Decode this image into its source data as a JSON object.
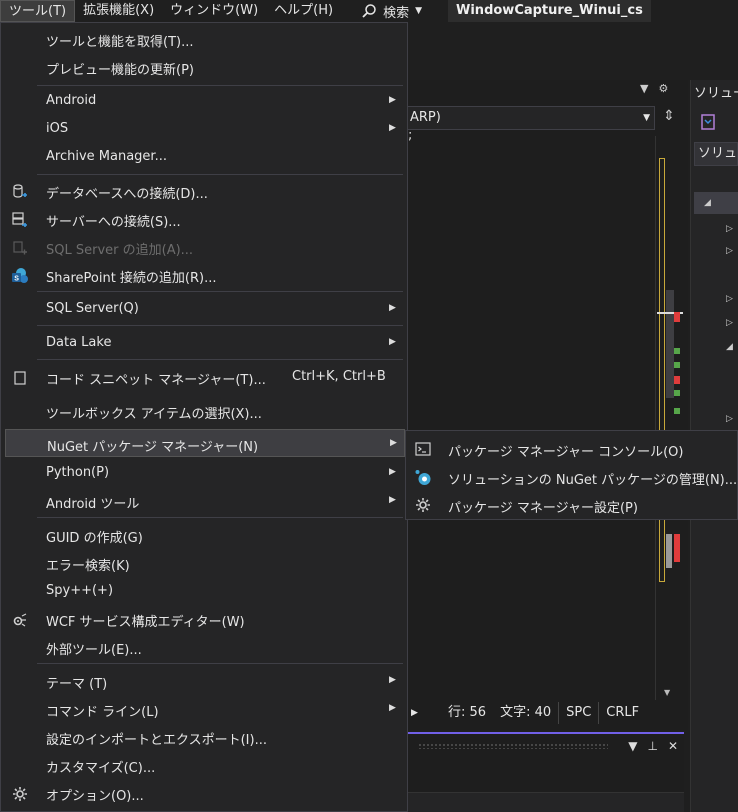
{
  "menubar": {
    "items": [
      {
        "label": "ツール(T)",
        "active": true
      },
      {
        "label": "拡張機能(X)"
      },
      {
        "label": "ウィンドウ(W)"
      },
      {
        "label": "ヘルプ(H)"
      }
    ],
    "search_label": "検索",
    "window_title": "WindowCapture_Winui_cs"
  },
  "editor": {
    "combo_value": "ARP)",
    "code_text": ";",
    "status": {
      "line": "行: 56",
      "col": "文字: 40",
      "spc": "SPC",
      "crlf": "CRLF"
    }
  },
  "solution_explorer": {
    "title": "ソリュー",
    "search": "ソリュー"
  },
  "tools_menu": {
    "items": [
      {
        "label": "ツールと機能を取得(T)..."
      },
      {
        "label": "プレビュー機能の更新(P)"
      },
      {
        "label": "Android"
      },
      {
        "label": "iOS"
      },
      {
        "label": "Archive Manager..."
      },
      {
        "label": "データベースへの接続(D)..."
      },
      {
        "label": "サーバーへの接続(S)..."
      },
      {
        "label": "SQL Server の追加(A)..."
      },
      {
        "label": "SharePoint 接続の追加(R)..."
      },
      {
        "label": "SQL Server(Q)"
      },
      {
        "label": "Data Lake"
      },
      {
        "label": "コード スニペット マネージャー(T)...",
        "shortcut": "Ctrl+K, Ctrl+B"
      },
      {
        "label": "ツールボックス アイテムの選択(X)..."
      },
      {
        "label": "NuGet パッケージ マネージャー(N)"
      },
      {
        "label": "Python(P)"
      },
      {
        "label": "Android ツール"
      },
      {
        "label": "GUID の作成(G)"
      },
      {
        "label": "エラー検索(K)"
      },
      {
        "label": "Spy++(+)"
      },
      {
        "label": "WCF サービス構成エディター(W)"
      },
      {
        "label": "外部ツール(E)..."
      },
      {
        "label": "テーマ (T)"
      },
      {
        "label": "コマンド ライン(L)"
      },
      {
        "label": "設定のインポートとエクスポート(I)..."
      },
      {
        "label": "カスタマイズ(C)..."
      },
      {
        "label": "オプション(O)..."
      }
    ]
  },
  "nuget_submenu": {
    "items": [
      {
        "label": "パッケージ マネージャー コンソール(O)"
      },
      {
        "label": "ソリューションの NuGet パッケージの管理(N)..."
      },
      {
        "label": "パッケージ マネージャー設定(P)"
      }
    ]
  },
  "colors": {
    "menu_bg": "#252526",
    "highlight": "#3e3e42",
    "accent": "#7160e8",
    "disabled": "#6d6d6d"
  }
}
